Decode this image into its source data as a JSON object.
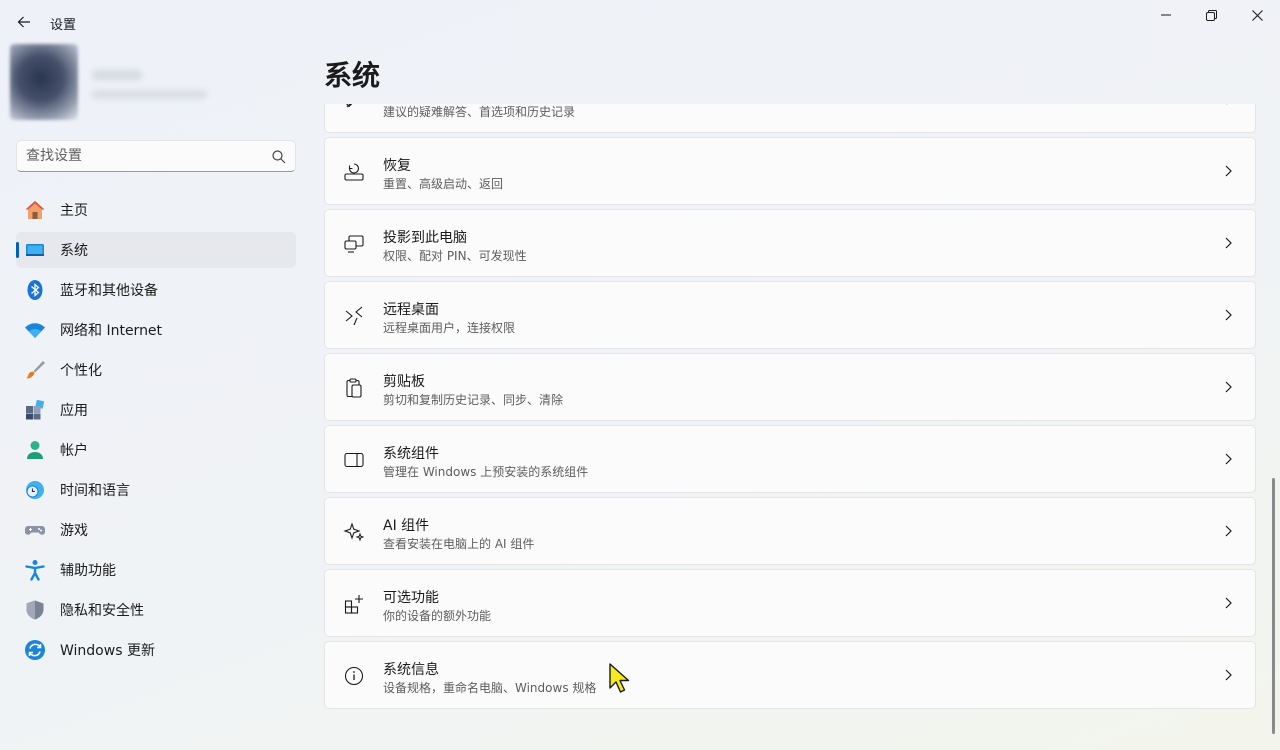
{
  "window": {
    "title": "设置"
  },
  "search": {
    "placeholder": "查找设置"
  },
  "page": {
    "title": "系统"
  },
  "nav": [
    {
      "label": "主页",
      "icon": "home-icon"
    },
    {
      "label": "系统",
      "icon": "system-icon",
      "active": true
    },
    {
      "label": "蓝牙和其他设备",
      "icon": "bluetooth-icon"
    },
    {
      "label": "网络和 Internet",
      "icon": "wifi-icon"
    },
    {
      "label": "个性化",
      "icon": "brush-icon"
    },
    {
      "label": "应用",
      "icon": "apps-icon"
    },
    {
      "label": "帐户",
      "icon": "account-icon"
    },
    {
      "label": "时间和语言",
      "icon": "clock-globe-icon"
    },
    {
      "label": "游戏",
      "icon": "gamepad-icon"
    },
    {
      "label": "辅助功能",
      "icon": "accessibility-icon"
    },
    {
      "label": "隐私和安全性",
      "icon": "shield-icon"
    },
    {
      "label": "Windows 更新",
      "icon": "update-icon"
    }
  ],
  "cards": [
    {
      "title": "",
      "subtitle": "建议的疑难解答、首选项和历史记录",
      "icon": "wrench-icon"
    },
    {
      "title": "恢复",
      "subtitle": "重置、高级启动、返回",
      "icon": "recovery-icon"
    },
    {
      "title": "投影到此电脑",
      "subtitle": "权限、配对 PIN、可发现性",
      "icon": "project-icon"
    },
    {
      "title": "远程桌面",
      "subtitle": "远程桌面用户，连接权限",
      "icon": "remote-desktop-icon"
    },
    {
      "title": "剪贴板",
      "subtitle": "剪切和复制历史记录、同步、清除",
      "icon": "clipboard-icon"
    },
    {
      "title": "系统组件",
      "subtitle": "管理在 Windows 上预安装的系统组件",
      "icon": "components-icon"
    },
    {
      "title": "AI 组件",
      "subtitle": "查看安装在电脑上的 AI 组件",
      "icon": "sparkle-icon"
    },
    {
      "title": "可选功能",
      "subtitle": "你的设备的额外功能",
      "icon": "optional-features-icon"
    },
    {
      "title": "系统信息",
      "subtitle": "设备规格，重命名电脑、Windows 规格",
      "icon": "info-icon"
    }
  ]
}
